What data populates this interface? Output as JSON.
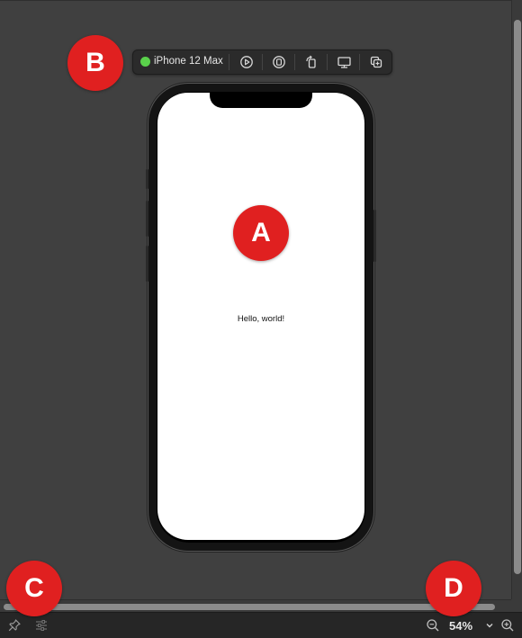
{
  "toolbar": {
    "device_name": "iPhone 12 Max",
    "status_color": "#5ad14b",
    "buttons": [
      {
        "name": "live-preview-icon"
      },
      {
        "name": "selectable-mode-icon"
      },
      {
        "name": "rotate-device-icon"
      },
      {
        "name": "device-settings-icon"
      },
      {
        "name": "duplicate-preview-icon"
      }
    ]
  },
  "preview": {
    "text": "Hello, world!"
  },
  "callouts": {
    "a": "A",
    "b": "B",
    "c": "C",
    "d": "D",
    "color": "#e02020"
  },
  "bottombar": {
    "zoom": "54%"
  }
}
